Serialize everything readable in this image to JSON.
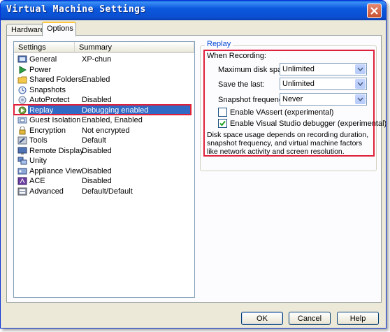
{
  "window": {
    "title": "Virtual Machine Settings"
  },
  "tabs": [
    {
      "label": "Hardware"
    },
    {
      "label": "Options"
    }
  ],
  "list": {
    "headers": {
      "settings": "Settings",
      "summary": "Summary"
    },
    "items": [
      {
        "name": "General",
        "summary": "XP-chun",
        "icon": "general-icon"
      },
      {
        "name": "Power",
        "summary": "",
        "icon": "power-icon"
      },
      {
        "name": "Shared Folders",
        "summary": "Enabled",
        "icon": "folder-icon"
      },
      {
        "name": "Snapshots",
        "summary": "",
        "icon": "snapshot-icon"
      },
      {
        "name": "AutoProtect",
        "summary": "Disabled",
        "icon": "autoprotect-icon"
      },
      {
        "name": "Replay",
        "summary": "Debugging enabled",
        "icon": "replay-icon"
      },
      {
        "name": "Guest Isolation",
        "summary": "Enabled, Enabled",
        "icon": "isolation-icon"
      },
      {
        "name": "Encryption",
        "summary": "Not encrypted",
        "icon": "lock-icon"
      },
      {
        "name": "Tools",
        "summary": "Default",
        "icon": "tools-icon"
      },
      {
        "name": "Remote Display",
        "summary": "Disabled",
        "icon": "display-icon"
      },
      {
        "name": "Unity",
        "summary": "",
        "icon": "unity-icon"
      },
      {
        "name": "Appliance View",
        "summary": "Disabled",
        "icon": "appliance-icon"
      },
      {
        "name": "ACE",
        "summary": "Disabled",
        "icon": "ace-icon"
      },
      {
        "name": "Advanced",
        "summary": "Default/Default",
        "icon": "advanced-icon"
      }
    ],
    "selected_index": 5
  },
  "replay": {
    "group_title": "Replay",
    "when_recording": "When Recording:",
    "max_disk_space": {
      "label": "Maximum disk space:",
      "value": "Unlimited"
    },
    "save_last": {
      "label": "Save the last:",
      "value": "Unlimited"
    },
    "snapshot_frequency": {
      "label": "Snapshot frequency:",
      "value": "Never"
    },
    "enable_vassert": {
      "label": "Enable VAssert (experimental)",
      "checked": false
    },
    "enable_vs_debugger": {
      "label": "Enable Visual Studio debugger (experimental)",
      "checked": true
    },
    "description": "Disk space usage depends on recording duration, snapshot frequency, and virtual machine factors like network activity and screen resolution."
  },
  "buttons": {
    "ok": "OK",
    "cancel": "Cancel",
    "help": "Help"
  },
  "colors": {
    "selection": "#316ac5",
    "highlight": "#e0203a",
    "titlebar": "#0a4fd0"
  }
}
